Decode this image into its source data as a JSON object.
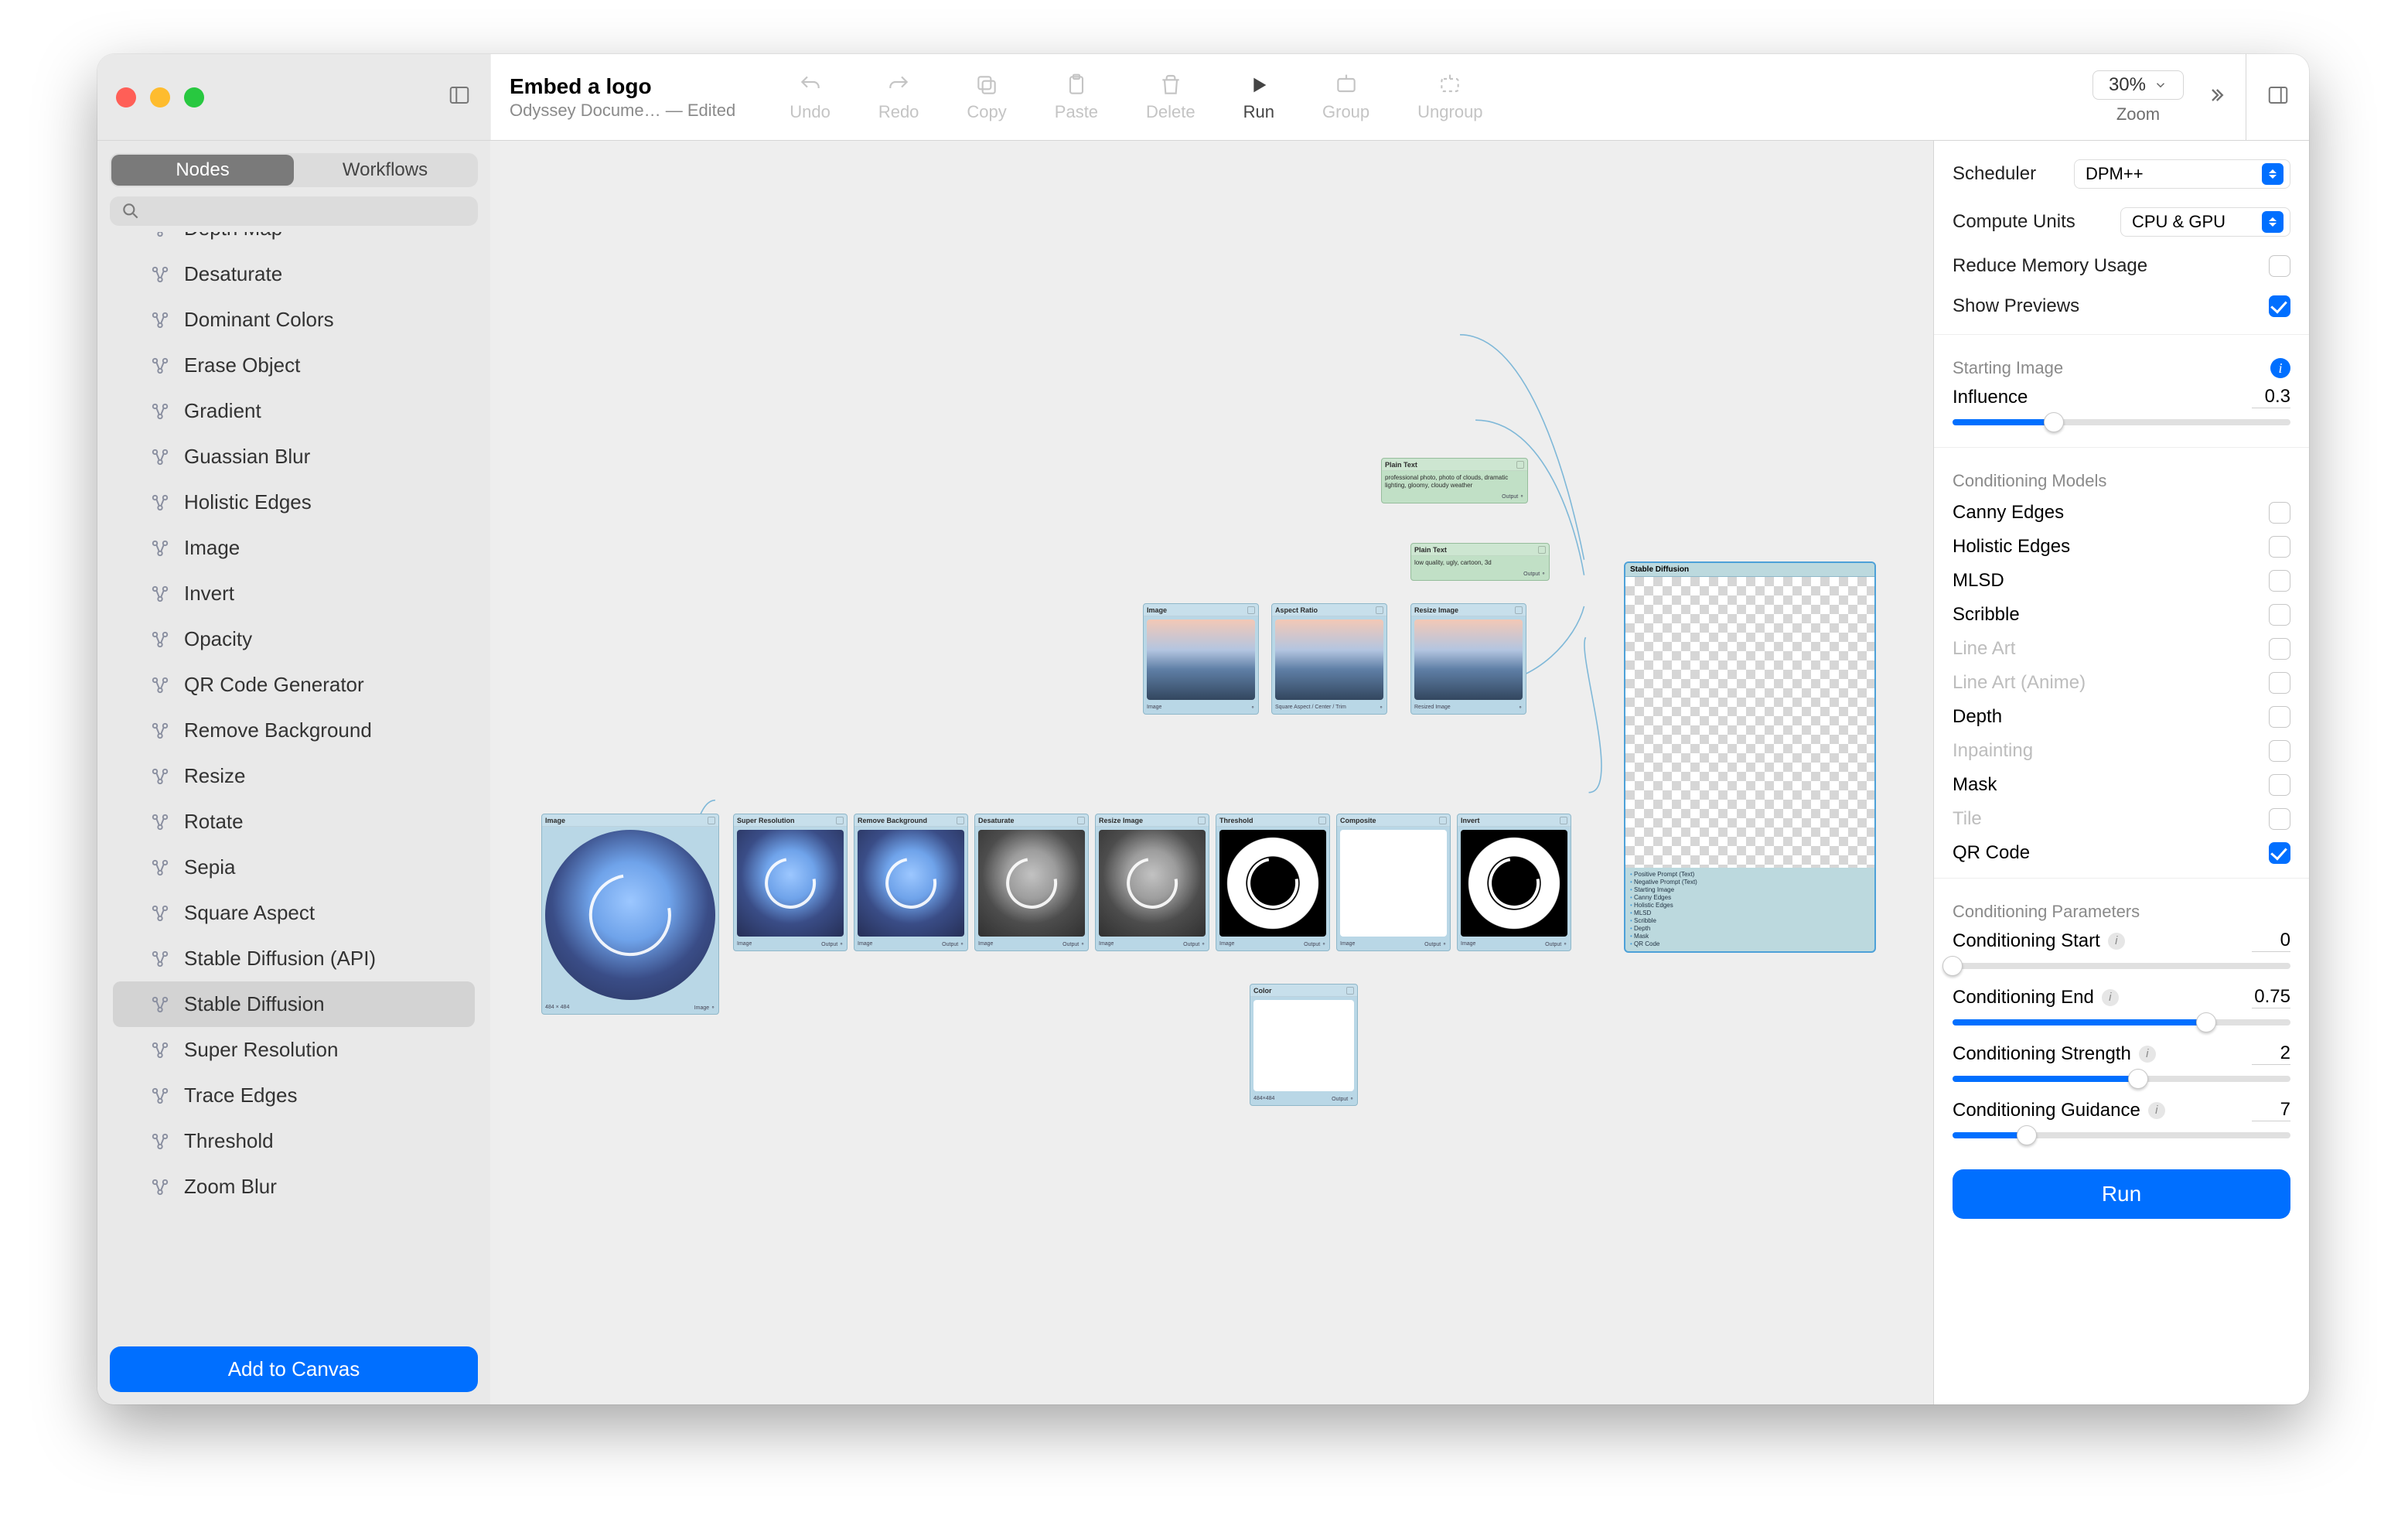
{
  "document": {
    "title": "Embed a logo",
    "subtitle": "Odyssey Docume… — Edited"
  },
  "toolbar": {
    "undo": "Undo",
    "redo": "Redo",
    "copy": "Copy",
    "paste": "Paste",
    "delete": "Delete",
    "run": "Run",
    "group": "Group",
    "ungroup": "Ungroup",
    "zoom_value": "30%",
    "zoom_label": "Zoom"
  },
  "sidebar": {
    "tabs": {
      "nodes": "Nodes",
      "workflows": "Workflows"
    },
    "search_placeholder": "",
    "add_to_canvas": "Add to Canvas",
    "nodes": [
      "Depth Map",
      "Desaturate",
      "Dominant Colors",
      "Erase Object",
      "Gradient",
      "Guassian Blur",
      "Holistic Edges",
      "Image",
      "Invert",
      "Opacity",
      "QR Code Generator",
      "Remove Background",
      "Resize",
      "Rotate",
      "Sepia",
      "Square Aspect",
      "Stable Diffusion (API)",
      "Stable Diffusion",
      "Super Resolution",
      "Trace Edges",
      "Threshold",
      "Zoom Blur"
    ],
    "selected_index": 17
  },
  "canvas": {
    "prompt_pos": "professional photo, photo of clouds, dramatic lighting, gloomy, cloudy weather",
    "prompt_neg": "low quality, ugly, cartoon, 3d",
    "chain_labels": [
      "Image",
      "Super Resolution",
      "Remove Background",
      "Desaturate",
      "Resize Image",
      "Threshold",
      "Composite",
      "Invert"
    ],
    "top_row": [
      "Image",
      "Aspect Ratio",
      "Resize Image"
    ],
    "color_node": "Color",
    "sd_node": {
      "title": "Stable Diffusion",
      "inputs": [
        "Positive Prompt (Text)",
        "Negative Prompt (Text)",
        "Starting Image",
        "Canny Edges",
        "Holistic Edges",
        "MLSD",
        "Scribble",
        "Depth",
        "Mask",
        "QR Code"
      ]
    }
  },
  "inspector": {
    "scheduler_label": "Scheduler",
    "scheduler_value": "DPM++",
    "compute_label": "Compute Units",
    "compute_value": "CPU & GPU",
    "reduce_memory": "Reduce Memory Usage",
    "show_previews": "Show Previews",
    "show_previews_on": true,
    "section_start": "Starting Image",
    "influence_label": "Influence",
    "influence_value": "0.3",
    "influence_pct": 30,
    "section_cond": "Conditioning Models",
    "cond_models": [
      {
        "name": "Canny Edges",
        "on": false,
        "dis": false
      },
      {
        "name": "Holistic Edges",
        "on": false,
        "dis": false
      },
      {
        "name": "MLSD",
        "on": false,
        "dis": false
      },
      {
        "name": "Scribble",
        "on": false,
        "dis": false
      },
      {
        "name": "Line Art",
        "on": false,
        "dis": true
      },
      {
        "name": "Line Art (Anime)",
        "on": false,
        "dis": true
      },
      {
        "name": "Depth",
        "on": false,
        "dis": false
      },
      {
        "name": "Inpainting",
        "on": false,
        "dis": true
      },
      {
        "name": "Mask",
        "on": false,
        "dis": false
      },
      {
        "name": "Tile",
        "on": false,
        "dis": true
      },
      {
        "name": "QR Code",
        "on": true,
        "dis": false
      }
    ],
    "section_params": "Conditioning Parameters",
    "cond_start_label": "Conditioning Start",
    "cond_start_value": "0",
    "cond_start_pct": 0,
    "cond_end_label": "Conditioning End",
    "cond_end_value": "0.75",
    "cond_end_pct": 75,
    "cond_str_label": "Conditioning Strength",
    "cond_str_value": "2",
    "cond_str_pct": 55,
    "cond_guid_label": "Conditioning Guidance",
    "cond_guid_value": "7",
    "cond_guid_pct": 22,
    "run": "Run"
  }
}
